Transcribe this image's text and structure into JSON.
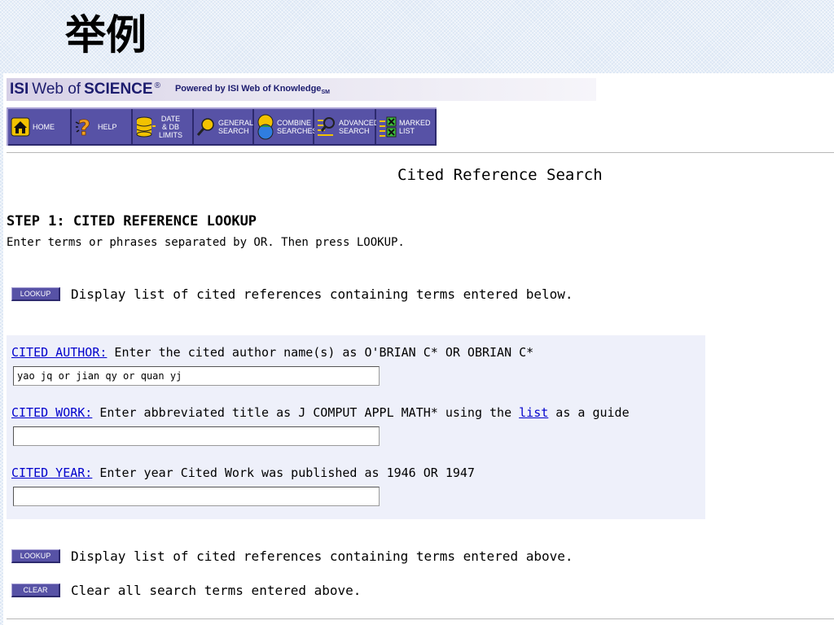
{
  "slide": {
    "title": "举例"
  },
  "banner": {
    "brand_isi": "ISI",
    "brand_web_of": "Web of",
    "brand_science": "SCIENCE",
    "brand_reg": "®",
    "powered_by": "Powered by ISI Web of Knowledge",
    "powered_sm": "SM"
  },
  "nav": {
    "items": [
      {
        "label": "Home",
        "icon": "home-icon"
      },
      {
        "label": "Help",
        "icon": "help-icon"
      },
      {
        "label": "Date & DB Limits",
        "icon": "database-icon"
      },
      {
        "label": "General Search",
        "icon": "magnifier-icon"
      },
      {
        "label": "Combine Searches",
        "icon": "combine-icon"
      },
      {
        "label": "Advanced Search",
        "icon": "advanced-search-icon"
      },
      {
        "label": "Marked List",
        "icon": "marked-list-icon"
      }
    ],
    "lines": [
      [
        "HOME"
      ],
      [
        "HELP"
      ],
      [
        "DATE",
        "& DB",
        "LIMITS"
      ],
      [
        "GENERAL",
        "SEARCH"
      ],
      [
        "COMBINE",
        "SEARCHES"
      ],
      [
        "ADVANCED",
        "SEARCH"
      ],
      [
        "MARKED",
        "LIST"
      ]
    ]
  },
  "page": {
    "heading": "Cited Reference Search"
  },
  "step1": {
    "title": "STEP 1: CITED REFERENCE LOOKUP",
    "instructions": "Enter terms or phrases separated by OR. Then press LOOKUP."
  },
  "lookup_top": {
    "button": "LOOKUP",
    "text": "Display list of cited references containing terms entered below."
  },
  "fields": {
    "author": {
      "link": "CITED AUTHOR:",
      "hint": " Enter the cited author name(s) as O'BRIAN C* OR OBRIAN C*",
      "value": "yao jq or jian qy or quan yj"
    },
    "work": {
      "link": "CITED WORK:",
      "hint_before": " Enter abbreviated title as J COMPUT APPL MATH* using the ",
      "list_link": "list",
      "hint_after": " as a guide",
      "value": ""
    },
    "year": {
      "link": "CITED YEAR:",
      "hint": " Enter year Cited Work was published as 1946 OR 1947",
      "value": ""
    }
  },
  "lookup_bottom": {
    "button": "LOOKUP",
    "text": "Display list of cited references containing terms entered above."
  },
  "clear": {
    "button": "CLEAR",
    "text": "Clear all search terms entered above."
  },
  "colors": {
    "nav_button": "#5752a6",
    "link": "#0000cc",
    "form_bg": "#eef0fa",
    "banner_text": "#1c1c6e"
  }
}
